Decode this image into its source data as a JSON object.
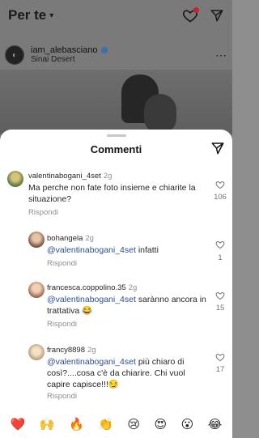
{
  "feed": {
    "title": "Per te",
    "post": {
      "username": "iam_alebasciano",
      "location": "Sinai Desert"
    }
  },
  "sheet": {
    "title": "Commenti"
  },
  "comments": [
    {
      "username": "valentinabogani_4set",
      "time": "2g",
      "text": "Ma perche non fate foto insieme e chiarite la situazione?",
      "reply": "Rispondi",
      "likes": "106"
    },
    {
      "username": "bohangela",
      "time": "2g",
      "mention": "@valentinabogani_4set",
      "text": " infatti",
      "reply": "Rispondi",
      "likes": "1"
    },
    {
      "username": "francesca.coppolino.35",
      "time": "2g",
      "mention": "@valentinabogani_4set",
      "text": " sarànno ancora in trattativa 😂",
      "reply": "Rispondi",
      "likes": "15"
    },
    {
      "username": "francy8898",
      "time": "2g",
      "mention": "@valentinabogani_4set",
      "text": " più chiaro di così?....cosa c'è da chiarire. Chi vuol capire capisce!!!😏",
      "reply": "Rispondi",
      "likes": "17"
    }
  ],
  "emojis": [
    "❤️",
    "🙌",
    "🔥",
    "👏",
    "😢",
    "😍",
    "😮",
    "😂"
  ],
  "colors": {
    "sheet": "#ffffff",
    "mention": "#2a4d8f",
    "notification_dot": "#c0262c"
  }
}
